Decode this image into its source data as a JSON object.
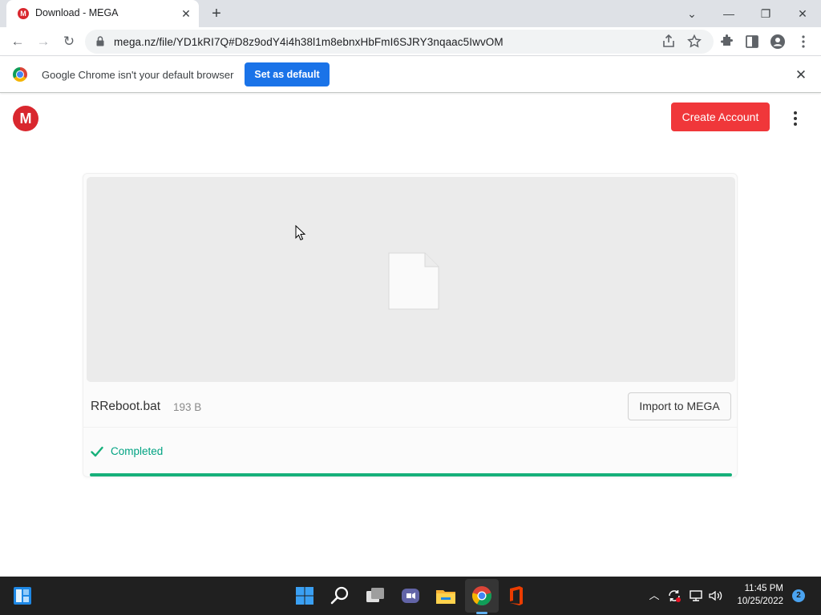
{
  "browser": {
    "tab": {
      "favicon_letter": "M",
      "title": "Download - MEGA",
      "close": "✕"
    },
    "new_tab": "+",
    "window_controls": {
      "tabsearch": "⌄",
      "minimize": "—",
      "restore": "❐",
      "close": "✕"
    },
    "nav": {
      "back": "←",
      "forward": "→",
      "reload": "↻"
    },
    "url": "mega.nz/file/YD1kRI7Q#D8z9odY4i4h38l1m8ebnxHbFmI6SJRY3nqaac5IwvOM",
    "infobar": {
      "message": "Google Chrome isn't your default browser",
      "button": "Set as default",
      "close": "✕"
    }
  },
  "mega": {
    "logo_letter": "M",
    "create_account": "Create Account",
    "file": {
      "name": "RReboot.bat",
      "size": "193 B"
    },
    "import_button": "Import to MEGA",
    "status": "Completed",
    "progress": 1.0,
    "colors": {
      "brand": "#d9272e",
      "create": "#f0373a",
      "success": "#16b07a"
    }
  },
  "taskbar": {
    "time": "11:45 PM",
    "date": "10/25/2022",
    "notifications": "2"
  }
}
